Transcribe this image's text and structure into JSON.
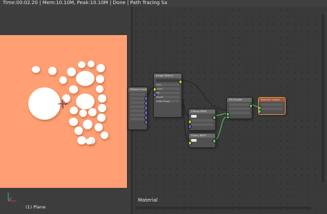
{
  "header": {
    "render_info": "Time:00:02.20 | Mem:10.10M, Peak:10.10M | Done | Path Tracing Sa"
  },
  "viewport": {
    "object_label": "(1) Plane",
    "background_color": "#ff9f73"
  },
  "node_editor": {
    "material_label": "Material",
    "nodes": {
      "left_partial": {
        "title": "Texture Coordinate"
      },
      "image_texture": {
        "title": "Image Texture",
        "options": [
          "Color",
          "Linear",
          "Flat",
          "Repeat",
          "Single Image"
        ]
      },
      "diffuse_bsdf": {
        "title": "Diffuse BSDF"
      },
      "glossy_bsdf": {
        "title": "Glossy BSDF"
      },
      "mix_shader": {
        "title": "Mix Shader"
      },
      "material_output": {
        "title": "Material Output"
      }
    }
  }
}
